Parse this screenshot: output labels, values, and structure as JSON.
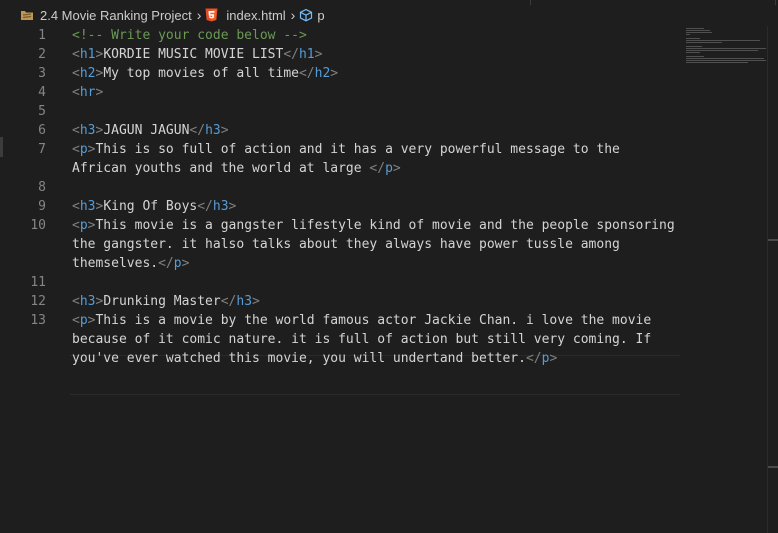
{
  "breadcrumb": {
    "folder": "2.4 Movie Ranking Project",
    "file": "index.html",
    "symbol": "p"
  },
  "icons": {
    "folder": "folder-icon",
    "file": "html5-icon",
    "symbol": "cube-icon",
    "separator": "chevron-right-icon"
  },
  "colors": {
    "background": "#1e1e1e",
    "tag_bracket": "#808080",
    "tag_name": "#569cd6",
    "comment": "#6a9955",
    "text": "#d4d4d4",
    "line_number": "#858585",
    "html5_orange": "#e44d26"
  },
  "editor": {
    "line_numbers": [
      "1",
      "2",
      "3",
      "4",
      "5",
      "6",
      "7",
      "8",
      "9",
      "10",
      "11",
      "12",
      "13"
    ],
    "lines": [
      {
        "comment": "<!-- Write your code below -->"
      },
      {
        "open": "h1",
        "text": "KORDIE MUSIC MOVIE LIST",
        "close": "h1"
      },
      {
        "open": "h2",
        "text": "My top movies of all time",
        "close": "h2"
      },
      {
        "open": "hr"
      },
      {},
      {
        "open": "h3",
        "text": "JAGUN JAGUN",
        "close": "h3"
      },
      {
        "open": "p",
        "text": "This is so full of action and it has a very powerful message to the",
        "cont": [
          "African youths and the world at large "
        ],
        "close": "p"
      },
      {},
      {
        "open": "h3",
        "text": "King Of Boys",
        "close": "h3"
      },
      {
        "open": "p",
        "text": "This movie is a gangster lifestyle kind of movie and the people sponsoring",
        "cont": [
          "the gangster. it halso talks about they always have power tussle among",
          "themselves."
        ],
        "close": "p"
      },
      {},
      {
        "open": "h3",
        "text": "Drunking Master",
        "close": "h3"
      },
      {
        "open": "p",
        "text": "This is a movie by the world famous actor Jackie Chan. i love the movie",
        "cont": [
          "because of it comic nature. it is full of action but still very coming. If",
          "you've ever watched this movie, you will undertand better."
        ],
        "close": "p"
      }
    ]
  }
}
